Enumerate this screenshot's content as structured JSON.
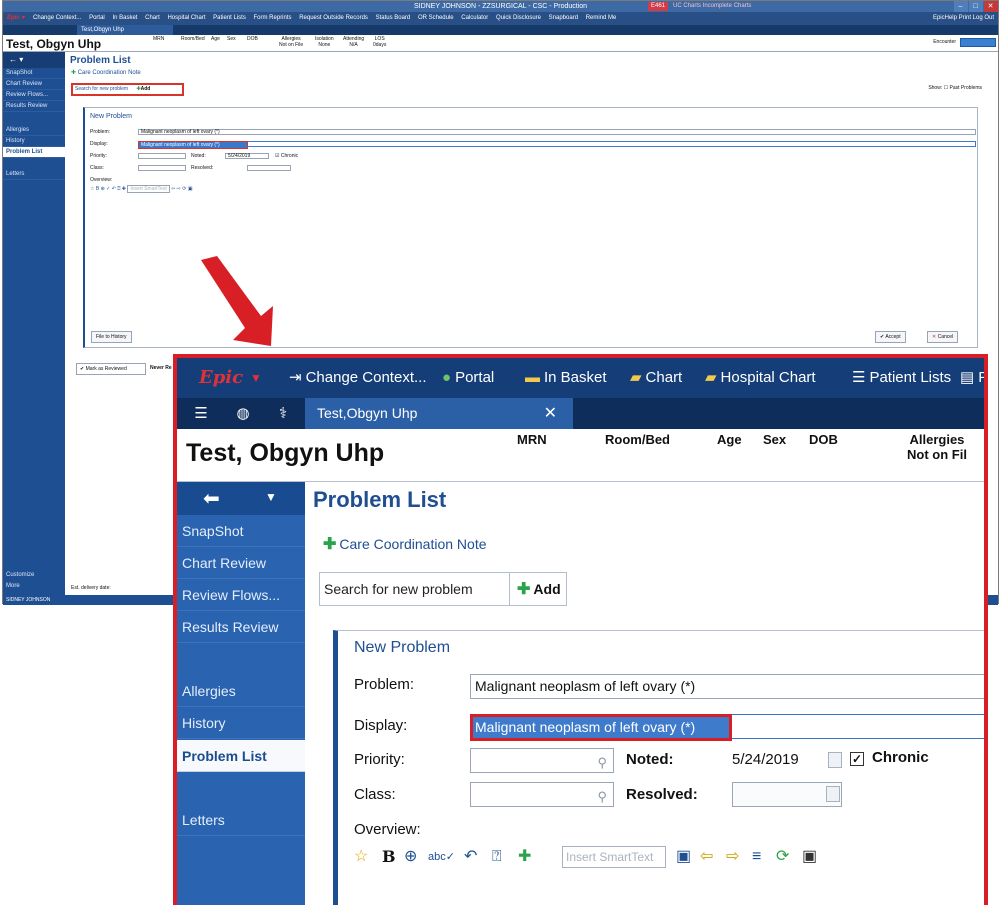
{
  "small": {
    "window_title": "SIDNEY JOHNSON - ZZSURGICAL - CSC - Production",
    "status_badge": "E461",
    "status_extra": "UC Charts   Incomplete Charts",
    "toolbar": [
      "Change Context...",
      "Portal",
      "In Basket",
      "Chart",
      "Hospital Chart",
      "Patient Lists",
      "Form Reprints",
      "Request Outside Records",
      "Status Board",
      "OR Schedule",
      "Calculator",
      "Quick Disclosure",
      "Snapboard",
      "Remind Me"
    ],
    "toolbar_right": "EpicHelp  Print  Log Out",
    "tab": "Test,Obgyn Uhp",
    "patient_name": "Test, Obgyn Uhp",
    "headers": [
      {
        "label": "MRN",
        "value": ""
      },
      {
        "label": "Room/Bed",
        "value": ""
      },
      {
        "label": "Age",
        "value": ""
      },
      {
        "label": "Sex",
        "value": ""
      },
      {
        "label": "DOB",
        "value": ""
      },
      {
        "label": "Allergies",
        "value": "Not on File"
      },
      {
        "label": "Isolation",
        "value": "None"
      },
      {
        "label": "Attending",
        "value": "N/A"
      },
      {
        "label": "LOS",
        "value": "0days"
      }
    ],
    "encounter": "Encounter",
    "search_btn": "Search",
    "sidebar": [
      "SnapShot",
      "Chart Review",
      "Review Flows...",
      "Results Review",
      "Allergies",
      "History",
      "Problem List",
      "Letters"
    ],
    "page_title": "Problem List",
    "care_note": "Care Coordination Note",
    "search_placeholder": "Search for new problem",
    "add_label": "Add",
    "show_label": "Show:",
    "past_problems": "Past Problems",
    "new_problem": "New Problem",
    "problem_label": "Problem:",
    "problem_value": "Malignant neoplasm of left ovary (*)",
    "display_label": "Display:",
    "display_value": "Malignant neoplasm of left ovary (*)",
    "priority_label": "Priority:",
    "noted_label": "Noted:",
    "noted_value": "5/24/2019",
    "chronic_label": "Chronic",
    "class_label": "Class:",
    "resolved_label": "Resolved:",
    "overview_label": "Overview:",
    "smarttext_placeholder": "Insert SmartText",
    "file_history": "File to History",
    "accept": "Accept",
    "cancel": "Cancel",
    "mark_reviewed": "Mark as Reviewed",
    "never_reviewed": "Never Re",
    "delivery": "Est. delivery date:",
    "customize": "Customize",
    "more": "More",
    "footer_user": "SIDNEY JOHNSON"
  },
  "zoom": {
    "logo": "Epic",
    "toolbar": [
      "Change Context...",
      "Portal",
      "In Basket",
      "Chart",
      "Hospital Chart",
      "Patient Lists",
      "Fo"
    ],
    "tab": "Test,Obgyn Uhp",
    "patient_name": "Test, Obgyn Uhp",
    "headers": [
      {
        "label": "MRN",
        "value": ""
      },
      {
        "label": "Room/Bed",
        "value": ""
      },
      {
        "label": "Age",
        "value": ""
      },
      {
        "label": "Sex",
        "value": ""
      },
      {
        "label": "DOB",
        "value": ""
      },
      {
        "label": "Allergies",
        "value": "Not on Fil"
      }
    ],
    "sidebar": [
      "SnapShot",
      "Chart Review",
      "Review Flows...",
      "Results Review",
      "Allergies",
      "History",
      "Problem List",
      "Letters"
    ],
    "page_title": "Problem List",
    "care_note": "Care Coordination Note",
    "search_placeholder": "Search for new problem",
    "add_label": "Add",
    "new_problem": "New Problem",
    "problem_label": "Problem:",
    "problem_value": "Malignant neoplasm of left ovary (*)",
    "display_label": "Display:",
    "display_value": "Malignant neoplasm of left ovary (*)",
    "priority_label": "Priority:",
    "noted_label": "Noted:",
    "noted_value": "5/24/2019",
    "chronic_label": "Chronic",
    "class_label": "Class:",
    "resolved_label": "Resolved:",
    "overview_label": "Overview:",
    "smarttext_placeholder": "Insert SmartText"
  },
  "colors": {
    "epic_red": "#e0313b",
    "nav_blue": "#1e4f93",
    "highlight_red": "#d81f26",
    "selection_blue": "#3f7bcb",
    "add_green": "#2aa44b"
  }
}
